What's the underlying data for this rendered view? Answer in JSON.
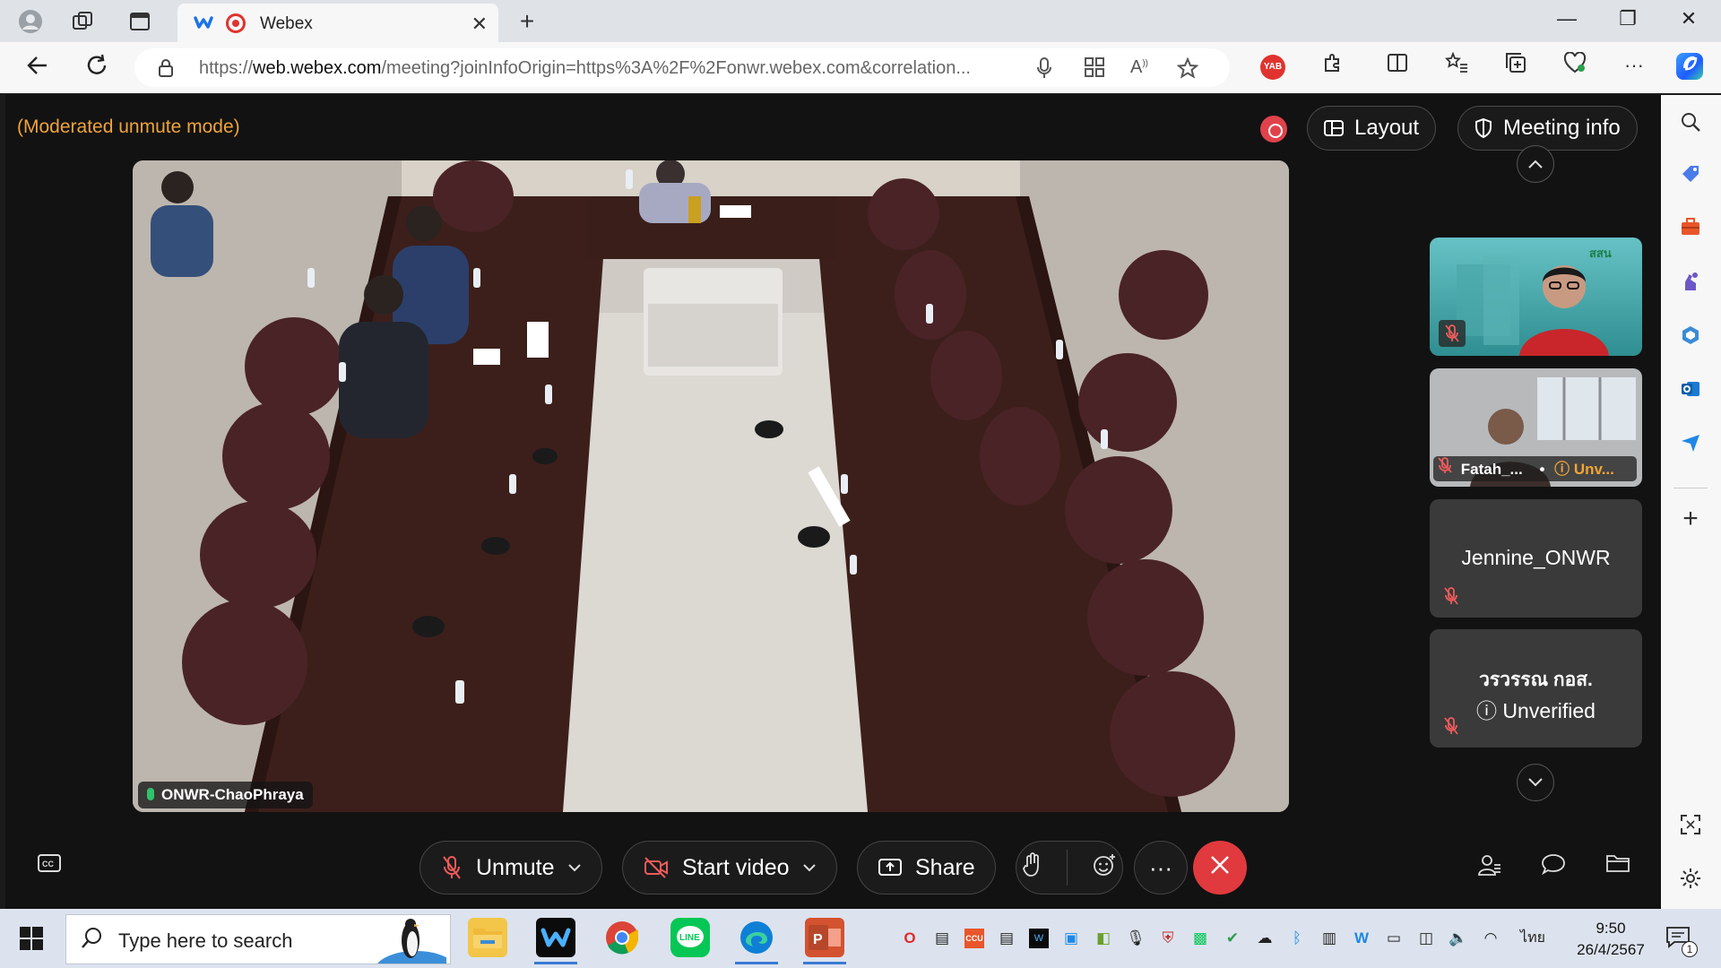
{
  "browser": {
    "tab_title": "Webex",
    "url_prefix": "https://",
    "url_domain": "web.webex.com",
    "url_rest": "/meeting?joinInfoOrigin=https%3A%2F%2Fonwr.webex.com&correlation...",
    "new_tab": "+",
    "tab_close": "✕",
    "win_minimize": "—",
    "win_restore": "❐",
    "win_close": "✕",
    "yab_label": "YAB"
  },
  "meeting": {
    "mode_text": "(Moderated unmute mode)",
    "layout_label": "Layout",
    "meeting_info_label": "Meeting info",
    "main_video_label": "ONWR-ChaoPhraya",
    "participants": [
      {
        "name": "",
        "status": ""
      },
      {
        "name": "Fatah_...",
        "status": "Unv..."
      },
      {
        "name": "Jennine_ONWR",
        "status": ""
      },
      {
        "name": "วรวรรณ กอส.",
        "status": "Unverified"
      }
    ],
    "controls": {
      "unmute": "Unmute",
      "start_video": "Start video",
      "share": "Share",
      "more": "···"
    }
  },
  "taskbar": {
    "search_placeholder": "Type here to search",
    "time": "9:50",
    "date": "26/4/2567",
    "lang": "ไทย",
    "notifications": "1"
  },
  "colors": {
    "accent_orange": "#f0a33a",
    "end_call_red": "#e03a3e",
    "record_red": "#e0424b"
  }
}
